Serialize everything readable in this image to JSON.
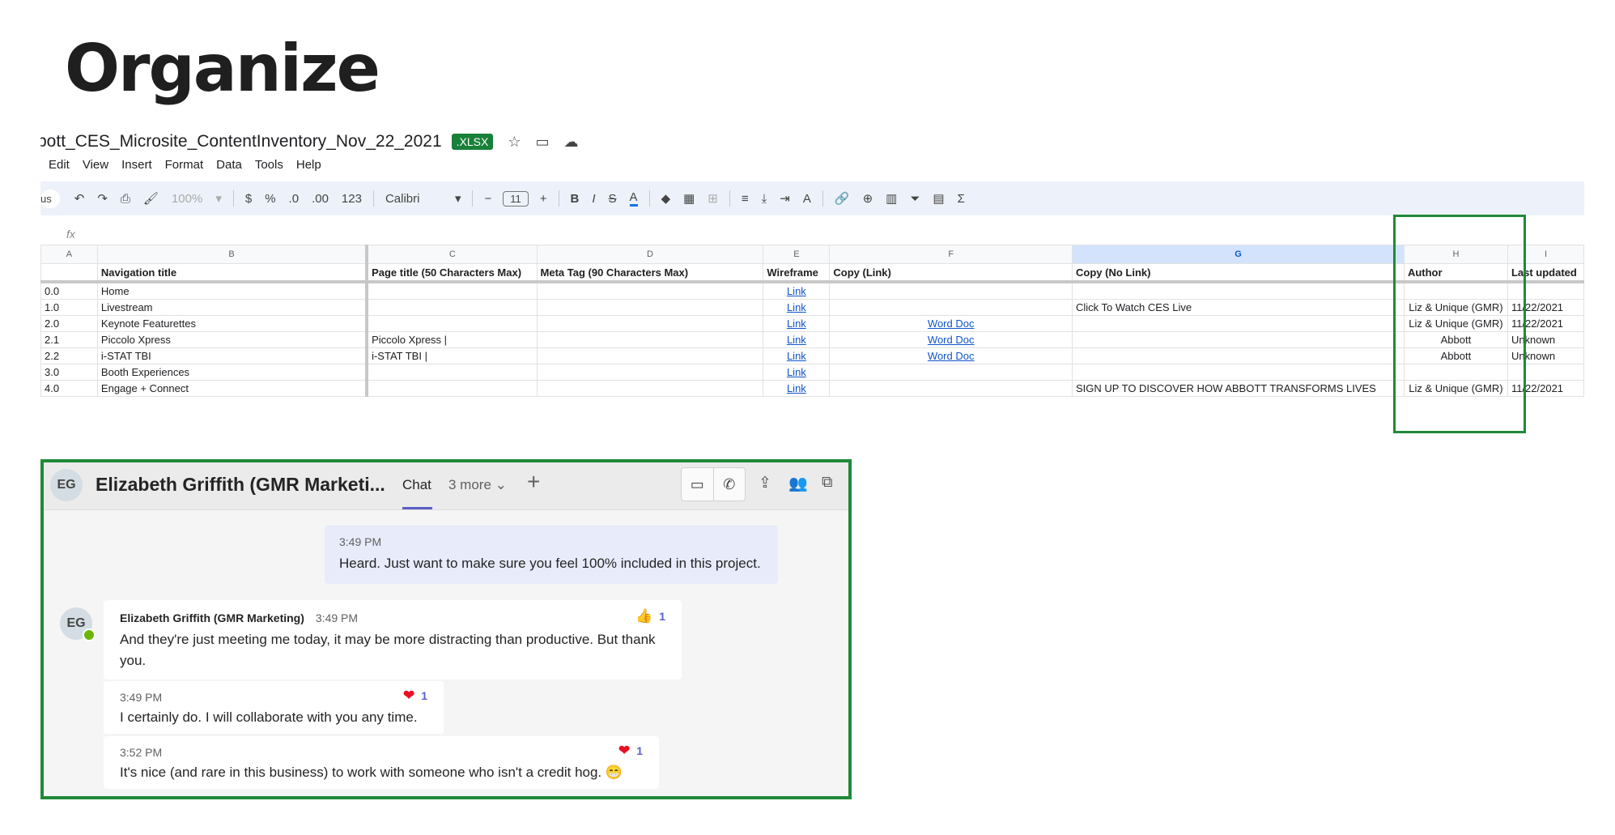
{
  "page_title": "Organize",
  "sheet": {
    "doc_title": "bott_CES_Microsite_ContentInventory_Nov_22_2021",
    "file_badge": ".XLSX",
    "menu": [
      "Edit",
      "View",
      "Insert",
      "Format",
      "Data",
      "Tools",
      "Help"
    ],
    "toolbar": {
      "search_fragment": "us",
      "zoom": "100%",
      "currency": "$",
      "percent": "%",
      "dec_decrease": ".0",
      "dec_increase": ".00",
      "number_format": "123",
      "font": "Calibri",
      "font_size": "11",
      "minus": "−",
      "plus": "+",
      "bold": "B",
      "italic": "I",
      "strike": "S",
      "text_color": "A",
      "sum": "Σ"
    },
    "formula_label": "fx",
    "column_letters": [
      "A",
      "B",
      "C",
      "D",
      "E",
      "F",
      "G",
      "H",
      "I"
    ],
    "header_row": [
      "",
      "Navigation title",
      "Page title (50 Characters Max)",
      "Meta Tag (90 Characters Max)",
      "Wireframe",
      "Copy (Link)",
      "Copy (No Link)",
      "Author",
      "Last updated"
    ],
    "rows": [
      [
        "0.0",
        "Home",
        "",
        "",
        "Link",
        "",
        "",
        "",
        ""
      ],
      [
        "1.0",
        "Livestream",
        "",
        "",
        "Link",
        "",
        "Click To Watch CES Live",
        "Liz & Unique (GMR)",
        "11/22/2021"
      ],
      [
        "2.0",
        "Keynote Featurettes",
        "",
        "",
        "Link",
        "Word Doc",
        "",
        "Liz & Unique (GMR)",
        "11/22/2021"
      ],
      [
        "2.1",
        "Piccolo Xpress",
        "Piccolo Xpress |",
        "",
        "Link",
        "Word Doc",
        "",
        "Abbott",
        "Unknown"
      ],
      [
        "2.2",
        "i-STAT TBI",
        "i-STAT TBI |",
        "",
        "Link",
        "Word Doc",
        "",
        "Abbott",
        "Unknown"
      ],
      [
        "3.0",
        "Booth Experiences",
        "",
        "",
        "Link",
        "",
        "",
        "",
        ""
      ],
      [
        "4.0",
        "Engage + Connect",
        "",
        "",
        "Link",
        "",
        "SIGN UP TO DISCOVER HOW ABBOTT TRANSFORMS LIVES",
        "Liz & Unique (GMR)",
        "11/22/2021"
      ]
    ]
  },
  "chat": {
    "header": {
      "initials": "EG",
      "name": "Elizabeth Griffith (GMR Marketi...",
      "tab": "Chat",
      "more": "3 more ⌄",
      "plus": "+"
    },
    "messages": [
      {
        "time": "3:49 PM",
        "text": "Heard. Just want to make sure you feel 100% included in this project."
      },
      {
        "sender": "Elizabeth Griffith (GMR Marketing)",
        "time": "3:49 PM",
        "text": "And they're just meeting me today, it may be more distracting than productive. But thank you.",
        "reaction_icon": "👍",
        "reaction_count": "1"
      },
      {
        "time": "3:49 PM",
        "text": "I certainly do. I will collaborate with you any time.",
        "reaction_icon": "❤",
        "reaction_count": "1"
      },
      {
        "time": "3:52 PM",
        "text": "It's nice (and rare in this business) to work with someone who isn't a credit hog. 😁",
        "reaction_icon": "❤",
        "reaction_count": "1"
      }
    ]
  },
  "colors": {
    "highlight_box": "#1f8a38",
    "teams_accent": "#5b5fc7",
    "link": "#1155cc",
    "reaction_heart": "#e81123"
  }
}
